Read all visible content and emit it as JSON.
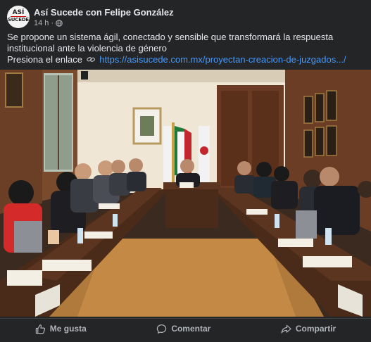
{
  "post": {
    "page_name": "Así Sucede con Felipe González",
    "timestamp": "14 h",
    "separator": "·",
    "avatar_text": {
      "line1": "ASÍ",
      "line2": "SUCEDE"
    },
    "text_line1": "Se propone un sistema ágil, conectado y sensible que transformará la respuesta institucional ante la violencia de género",
    "link_prompt": "Presiona el enlace",
    "link_url": "https://asisucede.com.mx/proyectan-creacion-de-juzgados.../"
  },
  "actions": {
    "like": "Me gusta",
    "comment": "Comentar",
    "share": "Compartir"
  },
  "colors": {
    "background": "#242526",
    "link": "#4599ff",
    "muted_text": "#b0b3b8"
  }
}
